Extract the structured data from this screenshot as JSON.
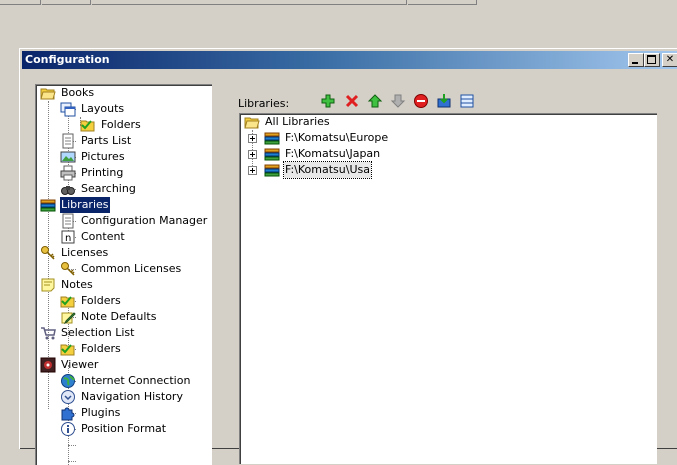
{
  "window": {
    "title": "Configuration"
  },
  "tree": {
    "items": [
      {
        "label": "Books",
        "icon": "folder-open-icon"
      },
      {
        "label": "Layouts",
        "icon": "layouts-icon"
      },
      {
        "label": "Folders",
        "icon": "folder-icon"
      },
      {
        "label": "Parts List",
        "icon": "document-icon"
      },
      {
        "label": "Pictures",
        "icon": "picture-icon"
      },
      {
        "label": "Printing",
        "icon": "printer-icon"
      },
      {
        "label": "Searching",
        "icon": "binoculars-icon"
      },
      {
        "label": "Libraries",
        "icon": "books-icon",
        "selected": true
      },
      {
        "label": "Configuration Manager",
        "icon": "document-icon"
      },
      {
        "label": "Content",
        "icon": "content-icon"
      },
      {
        "label": "Licenses",
        "icon": "key-icon"
      },
      {
        "label": "Common Licenses",
        "icon": "key-icon"
      },
      {
        "label": "Notes",
        "icon": "note-icon"
      },
      {
        "label": "Folders",
        "icon": "folder-icon"
      },
      {
        "label": "Note Defaults",
        "icon": "note-edit-icon"
      },
      {
        "label": "Selection List",
        "icon": "cart-icon"
      },
      {
        "label": "Folders",
        "icon": "folder-icon"
      },
      {
        "label": "Viewer",
        "icon": "viewer-icon"
      },
      {
        "label": "Internet Connection",
        "icon": "globe-icon"
      },
      {
        "label": "Navigation History",
        "icon": "navigation-icon"
      },
      {
        "label": "Plugins",
        "icon": "puzzle-icon"
      },
      {
        "label": "Position Format",
        "icon": "info-icon"
      }
    ]
  },
  "libraries": {
    "label": "Libraries:",
    "toolbar": [
      "add-icon",
      "delete-icon",
      "move-up-icon",
      "move-down-icon",
      "remove-icon",
      "import-icon",
      "properties-icon"
    ],
    "root": "All Libraries",
    "items": [
      {
        "label": "F:\\Komatsu\\Europe"
      },
      {
        "label": "F:\\Komatsu\\Japan"
      },
      {
        "label": "F:\\Komatsu\\Usa",
        "selected": true
      }
    ]
  }
}
